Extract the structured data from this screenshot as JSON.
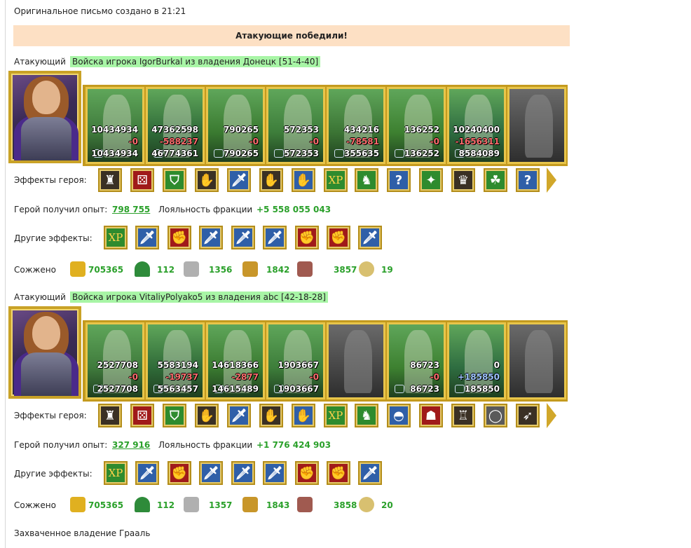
{
  "header": {
    "created": "Оригинальное письмо создано в 21:21",
    "result": "Атакующие победили!"
  },
  "labels": {
    "attacker": "Атакующий",
    "hero_effects": "Эффекты героя:",
    "hero_exp": "Герой получил опыт:",
    "loyalty": "Лояльность фракции",
    "other_effects": "Другие эффекты:",
    "burned": "Сожжено",
    "captured": "Захваченное владение",
    "xp": "XP"
  },
  "armies": [
    {
      "title": "Войска игрока IgorBurkal из владения Донецк [51-4-40]",
      "units": [
        {
          "start": "10434934",
          "change": "-0",
          "change_kind": "loss",
          "end": "10434934",
          "color": "#3f7a3c",
          "greyed": false
        },
        {
          "start": "47362598",
          "change": "-588237",
          "change_kind": "loss",
          "end": "46774361",
          "color": "#2f6a38",
          "greyed": false
        },
        {
          "start": "790265",
          "change": "-0",
          "change_kind": "loss",
          "end": "790265",
          "color": "#3a7a30",
          "greyed": false
        },
        {
          "start": "572353",
          "change": "-0",
          "change_kind": "loss",
          "end": "572353",
          "color": "#3d7d3a",
          "greyed": false
        },
        {
          "start": "434216",
          "change": "-78581",
          "change_kind": "loss",
          "end": "355635",
          "color": "#3b7434",
          "greyed": false
        },
        {
          "start": "136252",
          "change": "-0",
          "change_kind": "loss",
          "end": "136252",
          "color": "#3d8030",
          "greyed": false
        },
        {
          "start": "10240400",
          "change": "-1656311",
          "change_kind": "loss",
          "end": "8584089",
          "color": "#2e6c40",
          "greyed": false
        },
        {
          "start": "",
          "change": "",
          "change_kind": "",
          "end": "",
          "color": "#4a4a4a",
          "greyed": true
        }
      ],
      "exp": "798 755",
      "loyalty": "+5 558 055 043",
      "hero_effects": [
        "castle-icon",
        "dice-icon",
        "shield-icon",
        "handshake-icon",
        "sword-icon",
        "handshake-icon",
        "hand-icon",
        "xp-icon",
        "elf-xp-icon",
        "question-icon",
        "amulet-icon",
        "helmet-icon",
        "elf-icon",
        "question-icon"
      ],
      "other_effects": [
        "xp-icon",
        "sword-icon",
        "fist-sword-icon",
        "sword-icon",
        "sword-icon",
        "sword-icon",
        "fist-sword-icon",
        "fist-sword-icon",
        "sword-icon"
      ],
      "burned": [
        {
          "icon": "gold-icon",
          "value": "705365"
        },
        {
          "icon": "wood-icon",
          "value": "112"
        },
        {
          "icon": "ore-icon",
          "value": "1356"
        },
        {
          "icon": "grain-icon",
          "value": "1842"
        },
        {
          "icon": "stone-icon",
          "value": "3857"
        },
        {
          "icon": "fairy-icon",
          "value": "19"
        }
      ]
    },
    {
      "title": "Войска игрока VitaliyPolyako5 из владения abc [42-18-28]",
      "units": [
        {
          "start": "2527708",
          "change": "-0",
          "change_kind": "loss",
          "end": "2527708",
          "color": "#3f7a3c",
          "greyed": false
        },
        {
          "start": "5583194",
          "change": "-19737",
          "change_kind": "loss",
          "end": "5563457",
          "color": "#2f6a38",
          "greyed": false
        },
        {
          "start": "14618366",
          "change": "-2877",
          "change_kind": "loss",
          "end": "14615489",
          "color": "#3a7a30",
          "greyed": false
        },
        {
          "start": "1903667",
          "change": "-0",
          "change_kind": "loss",
          "end": "1903667",
          "color": "#3d7d3a",
          "greyed": false
        },
        {
          "start": "",
          "change": "",
          "change_kind": "",
          "end": "",
          "color": "#4a4a4a",
          "greyed": true
        },
        {
          "start": "86723",
          "change": "-0",
          "change_kind": "loss",
          "end": "86723",
          "color": "#3d8030",
          "greyed": false
        },
        {
          "start": "0",
          "change": "+185850",
          "change_kind": "gain",
          "end": "185850",
          "color": "#2e6c40",
          "greyed": false
        },
        {
          "start": "",
          "change": "",
          "change_kind": "",
          "end": "",
          "color": "#4a4a4a",
          "greyed": true
        }
      ],
      "exp": "327 916",
      "loyalty": "+1 776 424 903",
      "hero_effects": [
        "castle-icon",
        "dice-icon",
        "shield-icon",
        "handshake-icon",
        "sword-icon",
        "handshake-icon",
        "hand-icon",
        "xp-icon",
        "elf-xp-icon",
        "helm-icon",
        "mask-icon",
        "armor-icon",
        "ring-icon",
        "bow-icon"
      ],
      "other_effects": [
        "xp-icon",
        "sword-icon",
        "fist-sword-icon",
        "sword-icon",
        "sword-icon",
        "sword-icon",
        "fist-sword-icon",
        "fist-sword-icon",
        "sword-icon"
      ],
      "burned": [
        {
          "icon": "gold-icon",
          "value": "705365"
        },
        {
          "icon": "wood-icon",
          "value": "112"
        },
        {
          "icon": "ore-icon",
          "value": "1357"
        },
        {
          "icon": "grain-icon",
          "value": "1843"
        },
        {
          "icon": "stone-icon",
          "value": "3858"
        },
        {
          "icon": "fairy-icon",
          "value": "20"
        }
      ]
    }
  ],
  "captured_value": "Грааль"
}
